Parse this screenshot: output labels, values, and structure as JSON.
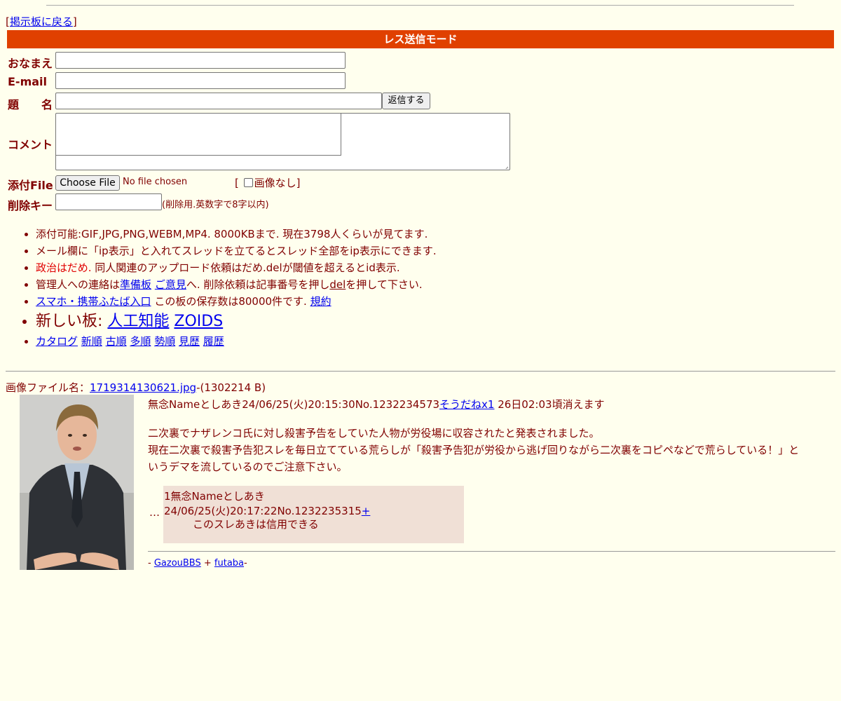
{
  "nav": {
    "back_link": "掲示板に戻る"
  },
  "mode_bar": {
    "title": "レス送信モード"
  },
  "form": {
    "name_label": "おなまえ",
    "email_label": "E-mail",
    "subject_label": "題　　名",
    "submit_label": "返信する",
    "comment_label": "コメント",
    "file_label": "添付File",
    "file_button": "Choose File",
    "file_status": "No file chosen",
    "no_image_label": "画像なし",
    "delkey_label": "削除キー",
    "delkey_note": "(削除用.英数字で8字以内)"
  },
  "rules": {
    "r1": "添付可能:GIF,JPG,PNG,WEBM,MP4. 8000KBまで. 現在3798人くらいが見てます.",
    "r2": "メール欄に「ip表示」と入れてスレッドを立てるとスレッド全部をip表示にできます.",
    "r3_red": "政治はだめ.",
    "r3_rest": " 同人関連のアップロード依頼はだめ.delが閾値を超えるとid表示.",
    "r4_a": "管理人への連絡は",
    "r4_link1": "準備板",
    "r4_link2": "ご意見",
    "r4_b": "へ. 削除依頼は記事番号を押し",
    "r4_del": "del",
    "r4_c": "を押して下さい.",
    "r5_link": "スマホ・携帯ふたば入口",
    "r5_text": " この板の保存数は80000件です. ",
    "r5_link2": "規約",
    "r6_text": "新しい板: ",
    "r6_link1": "人工知能",
    "r6_link2": "ZOIDS",
    "r7_links": [
      "カタログ",
      "新順",
      "古順",
      "多順",
      "勢順",
      "見歴",
      "履歴"
    ]
  },
  "thread": {
    "file_prefix": "画像ファイル名：",
    "file_name": "1719314130621.jpg",
    "file_size": "-(1302214 B)",
    "post_header": "無念Nameとしあき24/06/25(火)20:15:30No.1232234573",
    "soudane": "そうだねx1",
    "expiry": " 26日02:03頃消えます",
    "body_line1": "二次裏でナザレンコ氏に対し殺害予告をしていた人物が労役場に収容されたと発表されました。",
    "body_line2": "現在二次裏で殺害予告犯スレを毎日立てている荒らしが「殺害予告犯が労役から逃げ回りながら二次裏をコピペなどで荒らしている！」というデマを流しているのでご注意下さい。",
    "ellipsis": "…",
    "reply": {
      "header": "1無念Nameとしあき24/06/25(火)20:17:22No.1232235315",
      "plus": "+",
      "body": "このスレあきは信用できる"
    }
  },
  "footer": {
    "dash1": "- ",
    "link1": "GazouBBS",
    "plus": " + ",
    "link2": "futaba",
    "dash2": "-"
  },
  "colors": {
    "background": "#ffffee",
    "text": "#800000",
    "mode_bar": "#e04000",
    "reply_bg": "#f0e0d6",
    "link": "#0000ee"
  }
}
